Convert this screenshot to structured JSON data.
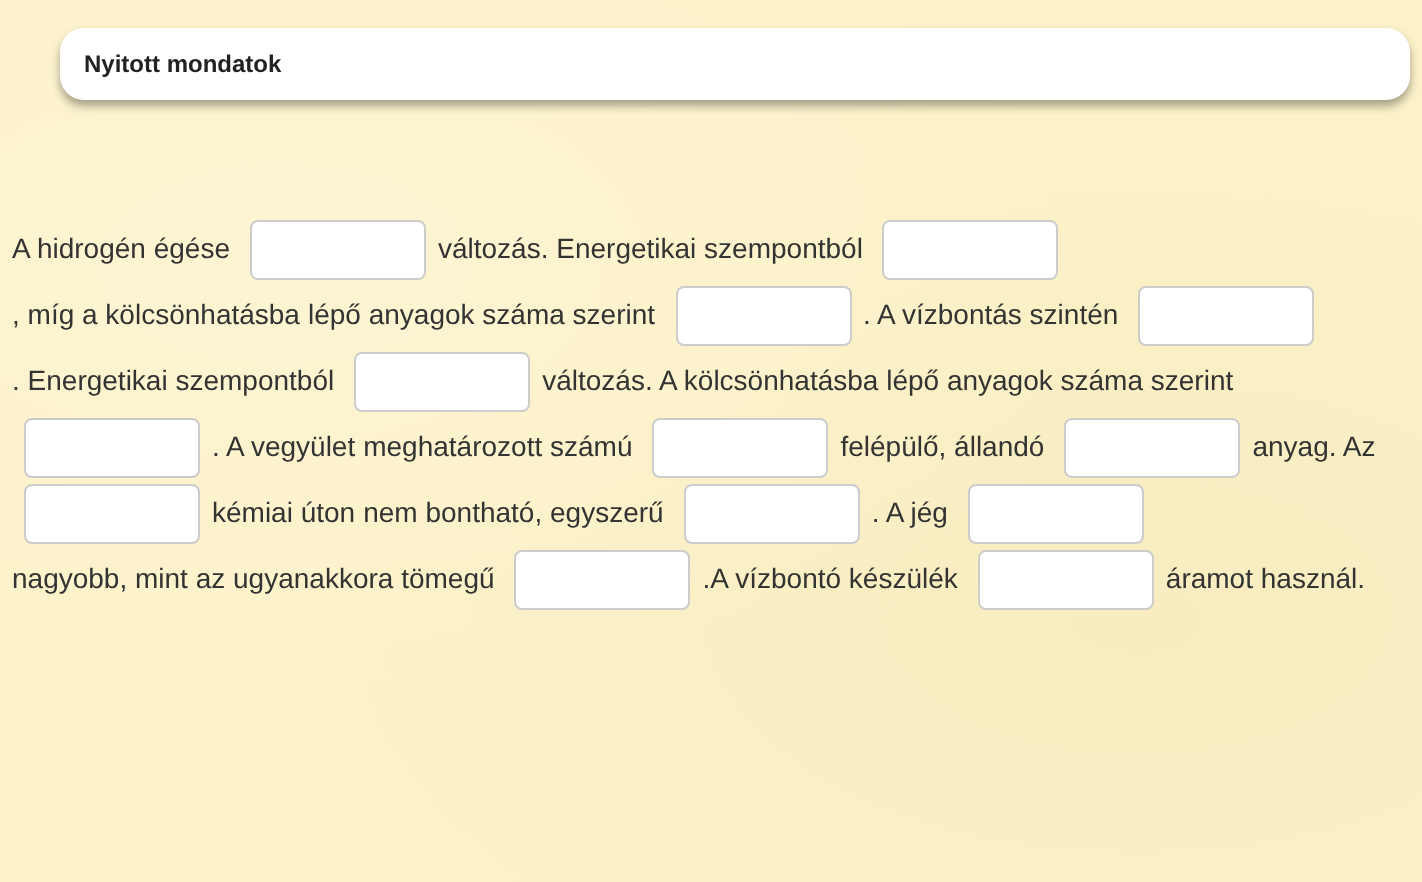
{
  "header": {
    "title": "Nyitott mondatok"
  },
  "segments": [
    {
      "kind": "text",
      "text": "A hidrogén égése"
    },
    {
      "kind": "blank"
    },
    {
      "kind": "text",
      "text": "változás. Energetikai szempontból"
    },
    {
      "kind": "blank"
    },
    {
      "kind": "text",
      "text": ", míg a kölcsönhatásba"
    },
    {
      "kind": "text",
      "text": "lépő anyagok száma szerint"
    },
    {
      "kind": "blank"
    },
    {
      "kind": "text",
      "text": ". A vízbontás szintén"
    },
    {
      "kind": "blank"
    },
    {
      "kind": "text",
      "text": ". Energetikai szempontból"
    },
    {
      "kind": "blank"
    },
    {
      "kind": "text",
      "text": "változás. A kölcsönhatásba lépő anyagok száma szerint"
    },
    {
      "kind": "blank"
    },
    {
      "kind": "text",
      "text": ". A vegyület"
    },
    {
      "kind": "text",
      "text": "meghatározott számú"
    },
    {
      "kind": "blank"
    },
    {
      "kind": "text",
      "text": "felépülő, állandó"
    },
    {
      "kind": "blank"
    },
    {
      "kind": "text",
      "text": "anyag. Az"
    },
    {
      "kind": "blank"
    },
    {
      "kind": "text",
      "text": "kémiai úton"
    },
    {
      "kind": "text",
      "text": "nem bontható, egyszerű"
    },
    {
      "kind": "blank"
    },
    {
      "kind": "text",
      "text": ". A jég"
    },
    {
      "kind": "blank"
    },
    {
      "kind": "text",
      "text": "nagyobb, mint az ugyanakkora tömegű"
    },
    {
      "kind": "blank"
    },
    {
      "kind": "text",
      "text": ".A vízbontó készülék"
    },
    {
      "kind": "blank"
    },
    {
      "kind": "text",
      "text": "áramot használ."
    }
  ]
}
